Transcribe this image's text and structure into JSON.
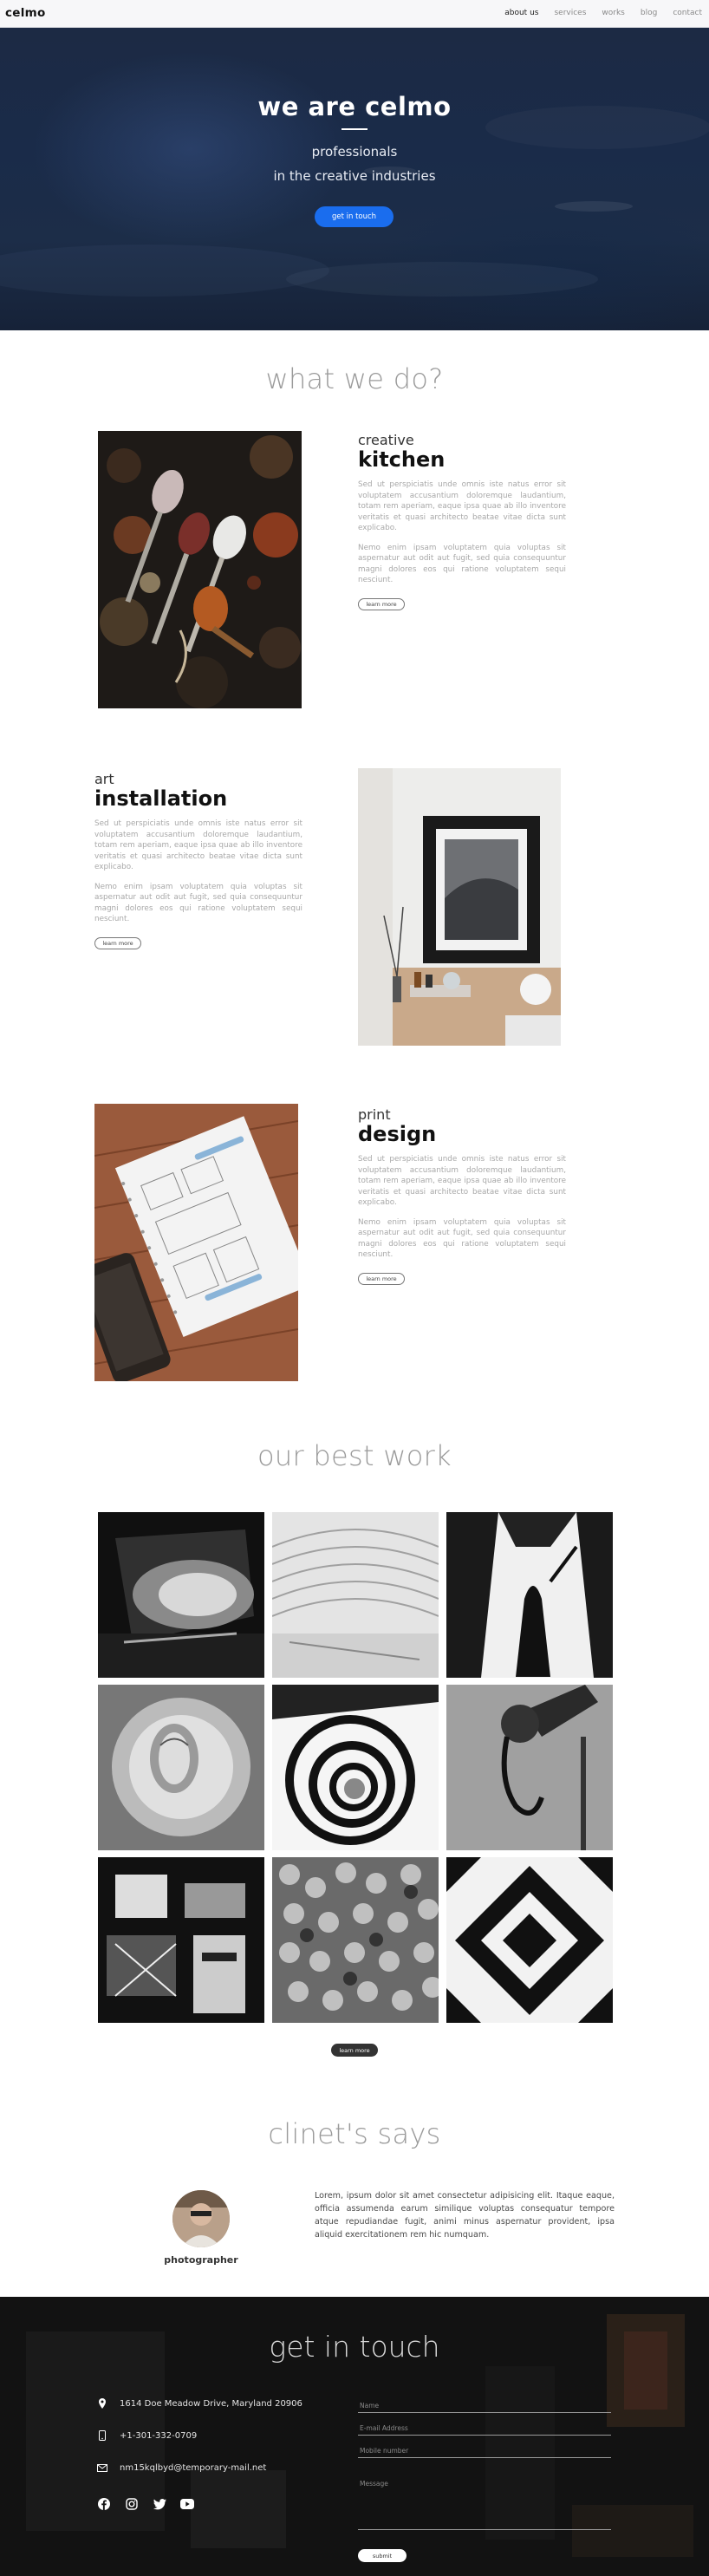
{
  "nav": {
    "logo": "celmo",
    "links": [
      "about us",
      "services",
      "works",
      "blog",
      "contact"
    ]
  },
  "hero": {
    "title": "we are celmo",
    "line1": "professionals",
    "line2": "in the creative industries",
    "button": "get in touch"
  },
  "services": {
    "title": "what we do?",
    "items": [
      {
        "kicker": "creative",
        "name": "kitchen",
        "p1": "Sed ut perspiciatis unde omnis iste natus error sit voluptatem accusantium doloremque laudantium, totam rem aperiam, eaque ipsa quae ab illo inventore veritatis et quasi architecto beatae vitae dicta sunt explicabo.",
        "p2": "Nemo enim ipsam voluptatem quia voluptas sit aspernatur aut odit aut fugit, sed quia consequuntur magni dolores eos qui ratione voluptatem sequi nesciunt.",
        "button": "learn more"
      },
      {
        "kicker": "art",
        "name": "installation",
        "p1": "Sed ut perspiciatis unde omnis iste natus error sit voluptatem accusantium doloremque laudantium, totam rem aperiam, eaque ipsa quae ab illo inventore veritatis et quasi architecto beatae vitae dicta sunt explicabo.",
        "p2": "Nemo enim ipsam voluptatem quia voluptas sit aspernatur aut odit aut fugit, sed quia consequuntur magni dolores eos qui ratione voluptatem sequi nesciunt.",
        "button": "learn more"
      },
      {
        "kicker": "print",
        "name": "design",
        "p1": "Sed ut perspiciatis unde omnis iste natus error sit voluptatem accusantium doloremque laudantium, totam rem aperiam, eaque ipsa quae ab illo inventore veritatis et quasi architecto beatae vitae dicta sunt explicabo.",
        "p2": "Nemo enim ipsam voluptatem quia voluptas sit aspernatur aut odit aut fugit, sed quia consequuntur magni dolores eos qui ratione voluptatem sequi nesciunt.",
        "button": "learn more"
      }
    ]
  },
  "work": {
    "title": "our best work",
    "button": "learn more"
  },
  "testimonial": {
    "title": "clinet's says",
    "name": "photographer",
    "quote": "Lorem, ipsum dolor sit amet consectetur adipisicing elit. Itaque eaque, officia assumenda earum similique voluptas consequatur tempore atque repudiandae fugit, animi minus aspernatur provident, ipsa aliquid exercitationem rem hic numquam."
  },
  "contact": {
    "title": "get in touch",
    "address": "1614 Doe Meadow Drive, Maryland 20906",
    "phone": "+1-301-332-0709",
    "email": "nm15kqlbyd@temporary-mail.net",
    "icons": [
      "map-pin-icon",
      "phone-icon",
      "envelope-icon"
    ],
    "socials": [
      "facebook-icon",
      "instagram-icon",
      "twitter-icon",
      "youtube-icon"
    ],
    "fields": {
      "name": "Name",
      "email": "E-mail Address",
      "phone": "Mobile number",
      "message": "Message"
    },
    "submit": "submit"
  },
  "colors": {
    "accent": "#1a6dee",
    "hero_bg": "#1a2b49",
    "footer_bg": "#141414"
  }
}
